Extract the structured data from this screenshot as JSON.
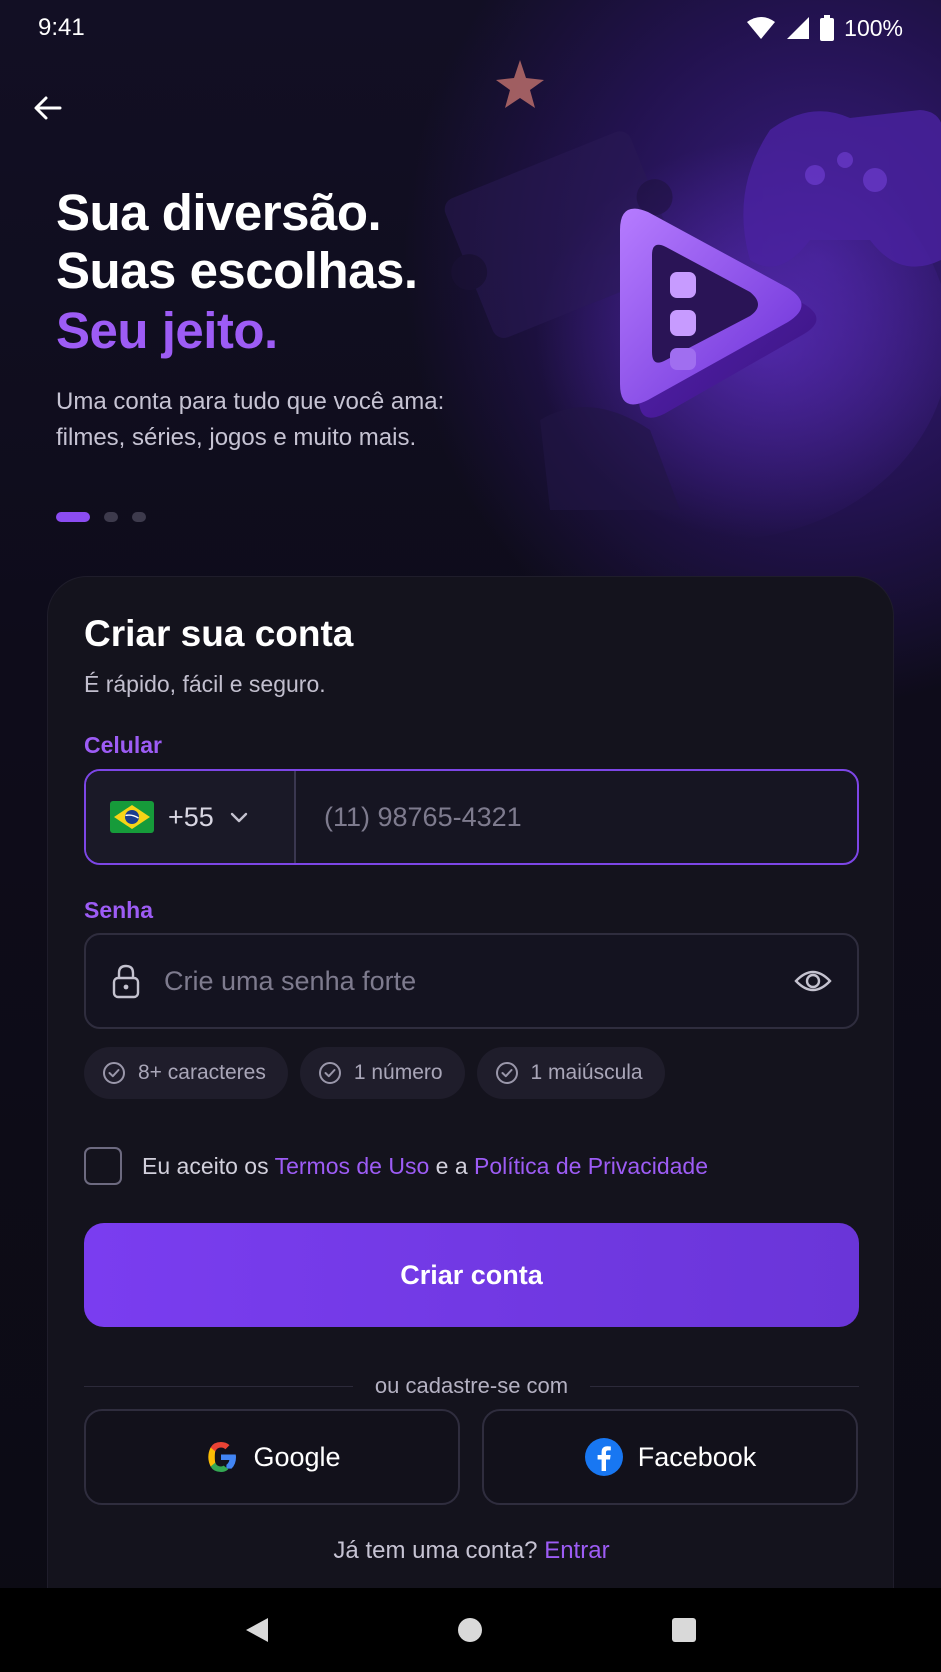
{
  "status_bar": {
    "time": "9:41",
    "battery": "100%"
  },
  "hero": {
    "line1": "Sua diversão.",
    "line2": "Suas escolhas.",
    "accent": "Seu jeito.",
    "subtitle": "Uma conta para tudo que você ama: filmes, séries, jogos e muito mais.",
    "carousel": {
      "pages": 3,
      "active_index": 0
    }
  },
  "card": {
    "title": "Criar sua conta",
    "subtitle": "É rápido, fácil e seguro."
  },
  "phone": {
    "label": "Celular",
    "country_code": "+55",
    "placeholder": "(11) 98765-4321"
  },
  "password": {
    "label": "Senha",
    "placeholder": "Crie uma senha forte",
    "requirements": [
      "8+ caracteres",
      "1 número",
      "1 maiúscula"
    ]
  },
  "terms": {
    "prefix": "Eu aceito os",
    "terms_link": "Termos de Uso",
    "middle": "e a",
    "privacy_link": "Política de Privacidade"
  },
  "primary_button": "Criar conta",
  "divider_text": "ou cadastre-se com",
  "social": {
    "google": "Google",
    "facebook": "Facebook"
  },
  "login": {
    "prompt": "Já tem uma conta?",
    "link": "Entrar"
  },
  "colors": {
    "accent": "#9d5cf5",
    "button": "#7a3df0",
    "background": "#0c0b14",
    "card": "#14131d"
  }
}
